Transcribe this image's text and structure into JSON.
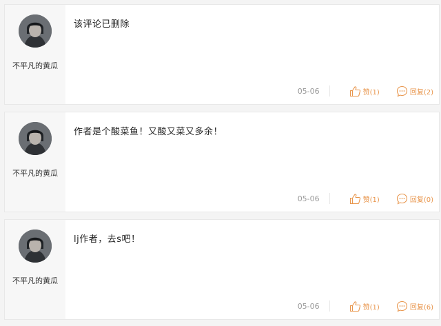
{
  "comments": [
    {
      "username": "不平凡的黄瓜",
      "text": "该评论已删除",
      "date": "05-06",
      "like_label": "赞(1)",
      "reply_label": "回复(2)"
    },
    {
      "username": "不平凡的黄瓜",
      "text": "作者是个酸菜鱼！又酸又菜又多余！",
      "date": "05-06",
      "like_label": "赞(1)",
      "reply_label": "回复(0)"
    },
    {
      "username": "不平凡的黄瓜",
      "text": "lj作者，去s吧！",
      "date": "05-06",
      "like_label": "赞(1)",
      "reply_label": "回复(6)"
    }
  ],
  "icons": {
    "like": "thumbs-up-icon",
    "reply": "speech-bubble-icon"
  },
  "colors": {
    "accent": "#e8954b",
    "date": "#999999",
    "sidebar_bg": "#f7f7f7"
  }
}
